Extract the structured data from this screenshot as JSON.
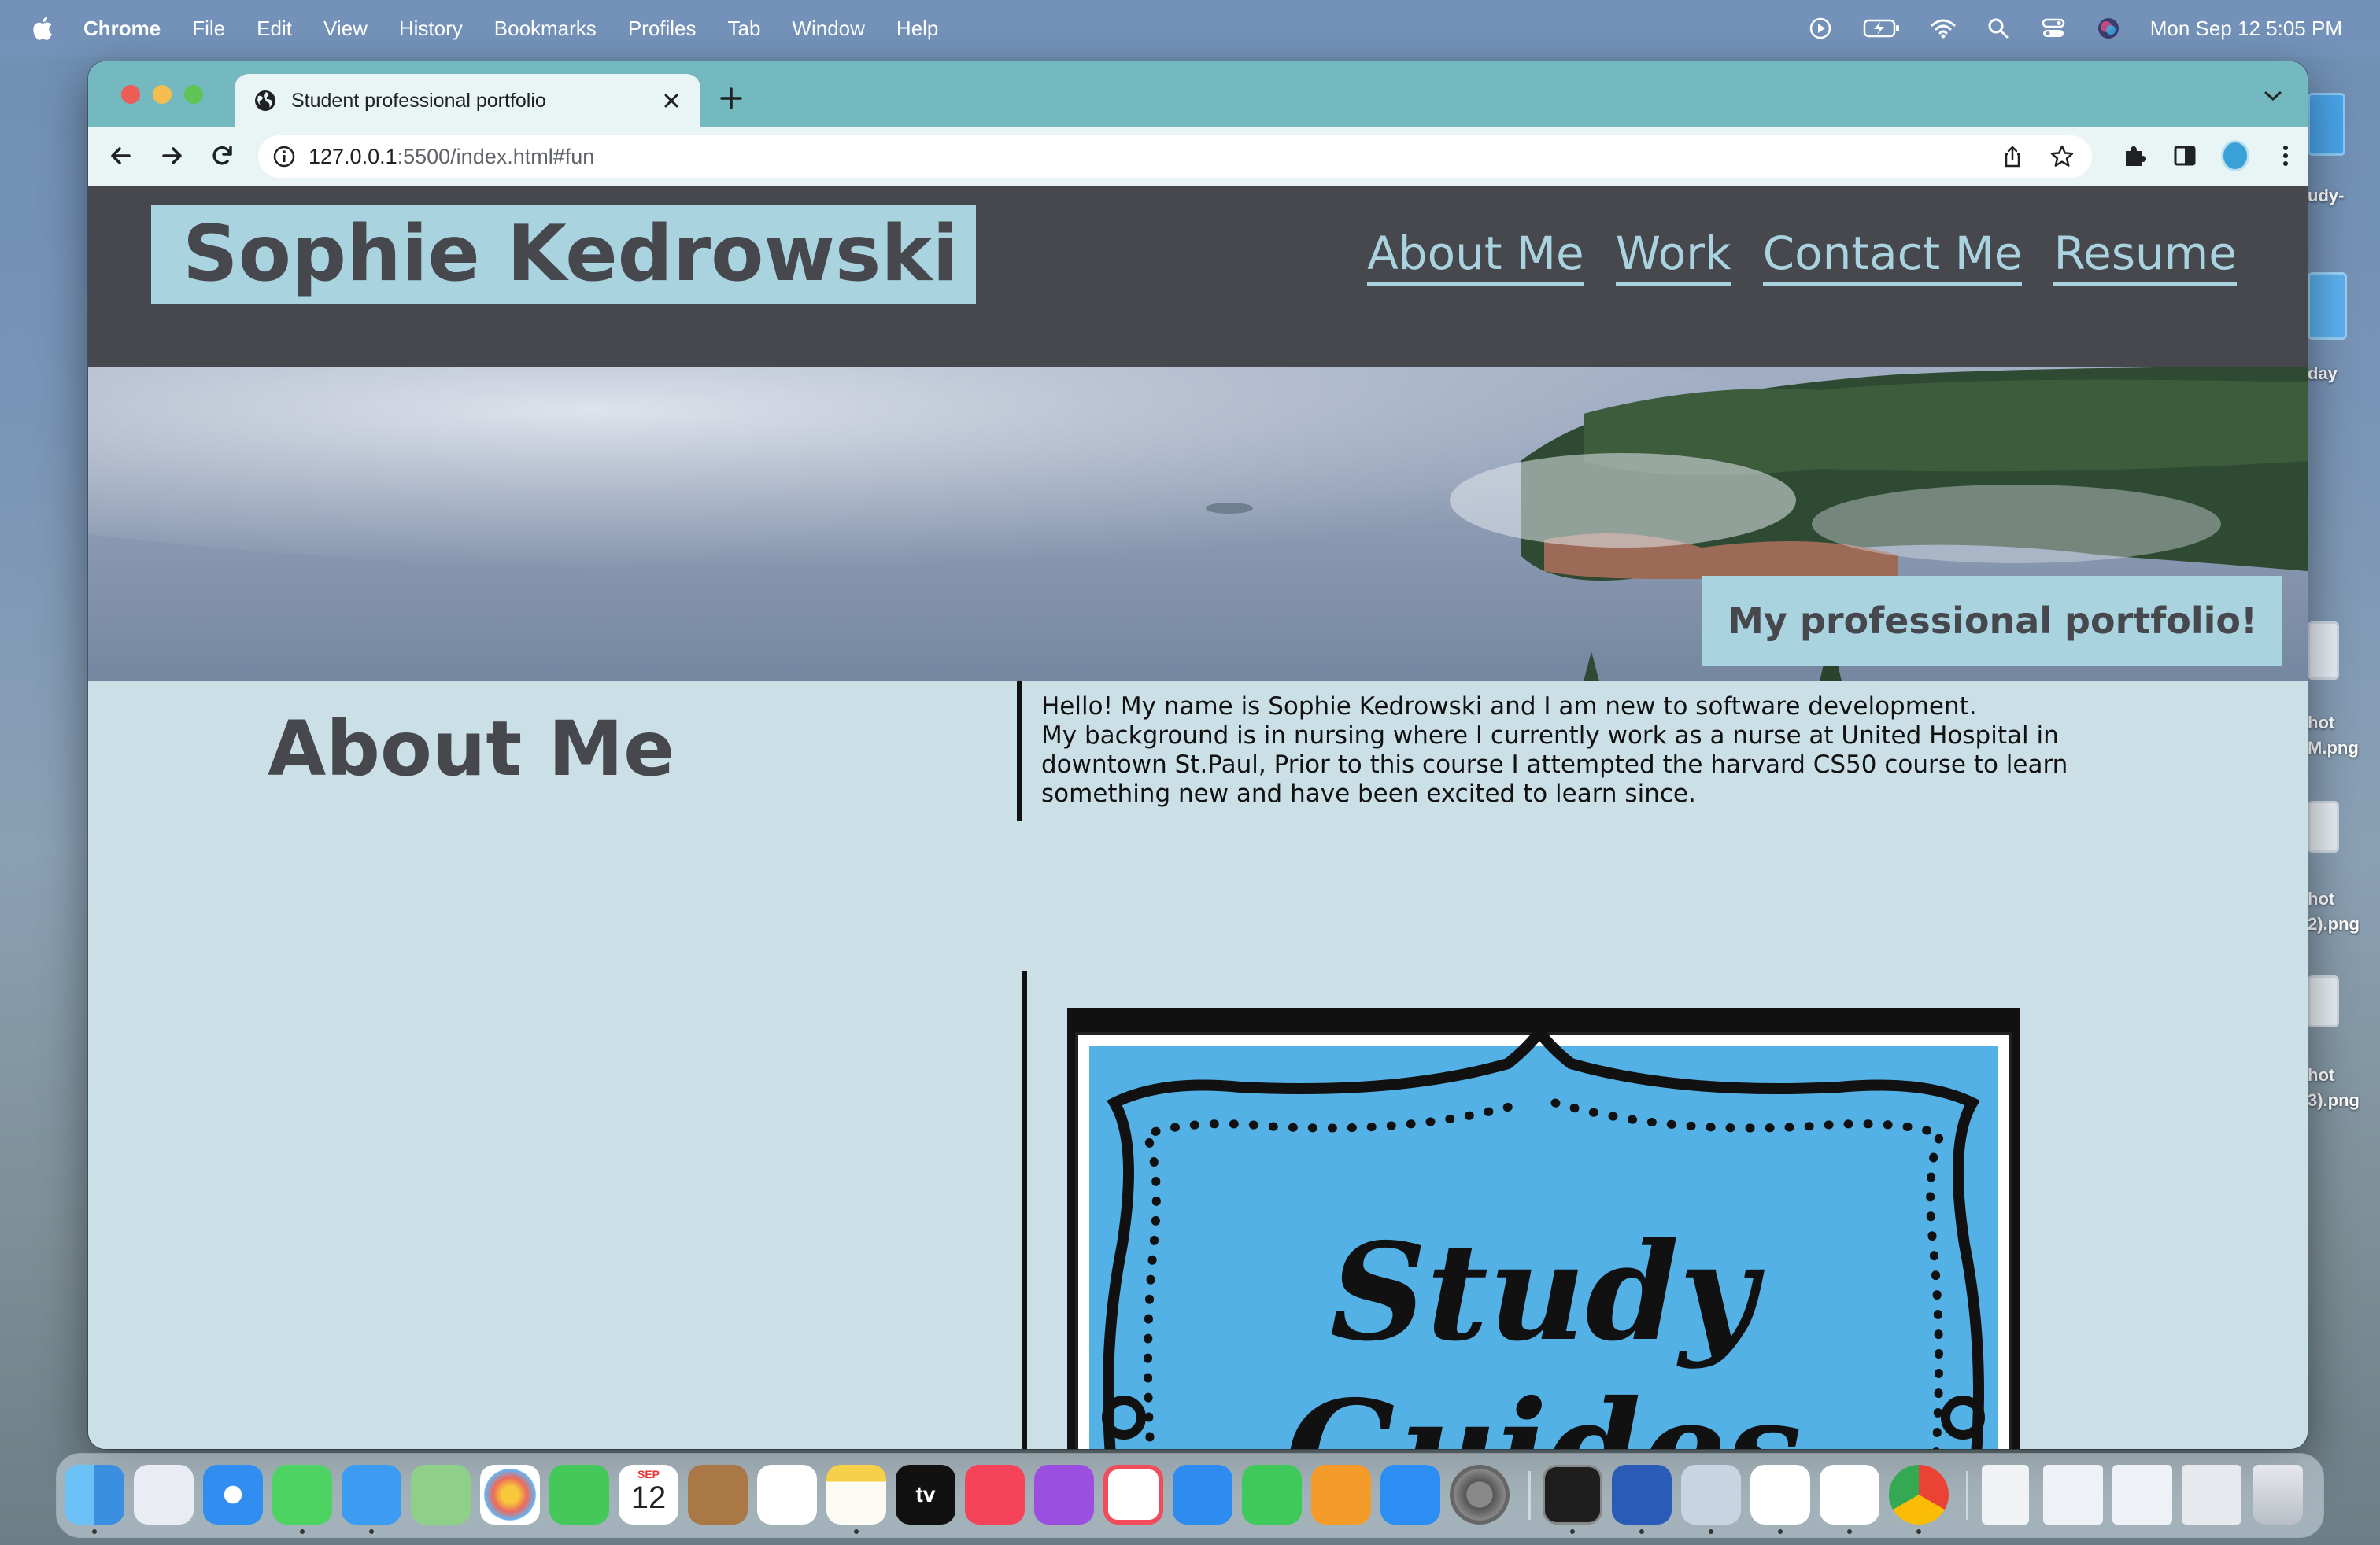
{
  "menubar": {
    "app_name": "Chrome",
    "items": [
      "File",
      "Edit",
      "View",
      "History",
      "Bookmarks",
      "Profiles",
      "Tab",
      "Window",
      "Help"
    ],
    "clock": "Mon Sep 12  5:05 PM"
  },
  "desktop": {
    "labels": [
      "udy-",
      "day",
      "hot",
      "M.png",
      "hot",
      "2).png",
      "hot",
      "3).png"
    ]
  },
  "browser": {
    "tab_title": "Student professional portfolio",
    "url_host": "127.0.0.1",
    "url_path": ":5500/index.html#fun"
  },
  "site": {
    "name": "Sophie Kedrowski",
    "nav": [
      "About Me",
      "Work",
      "Contact Me",
      "Resume"
    ],
    "hero_tagline": "My professional portfolio!",
    "about_heading": "About Me",
    "about_line1": "Hello! My name is Sophie Kedrowski and I am new to software development.",
    "about_line2": "My background is in nursing where I currently work as a nurse at United Hospital in downtown St.Paul, Prior to this course I attempted the harvard CS50 course to learn something new and have been excited to learn since.",
    "study_card_line1": "Study",
    "study_card_line2": "Guides"
  },
  "dock": {
    "apps": [
      "finder-icon",
      "launchpad-icon",
      "safari-icon",
      "messages-icon",
      "mail-icon",
      "maps-icon",
      "photos-icon",
      "facetime-icon",
      "calendar-icon",
      "contacts-icon",
      "reminders-icon",
      "notes-icon",
      "tv-icon",
      "music-icon",
      "podcasts-icon",
      "news-icon",
      "keynote-icon",
      "numbers-icon",
      "pages-icon",
      "app-store-icon",
      "system-settings-icon",
      "terminal-icon",
      "word-icon",
      "preview-icon",
      "slack-icon",
      "vscode-icon",
      "chrome-icon"
    ],
    "calendar_month": "SEP",
    "calendar_day": "12",
    "tv_label": "tv"
  },
  "colors": {
    "header_bg": "#47474e",
    "accent": "#a9d3de",
    "page_bg": "#cbe0e6",
    "tab_strip": "#74b8c0"
  }
}
